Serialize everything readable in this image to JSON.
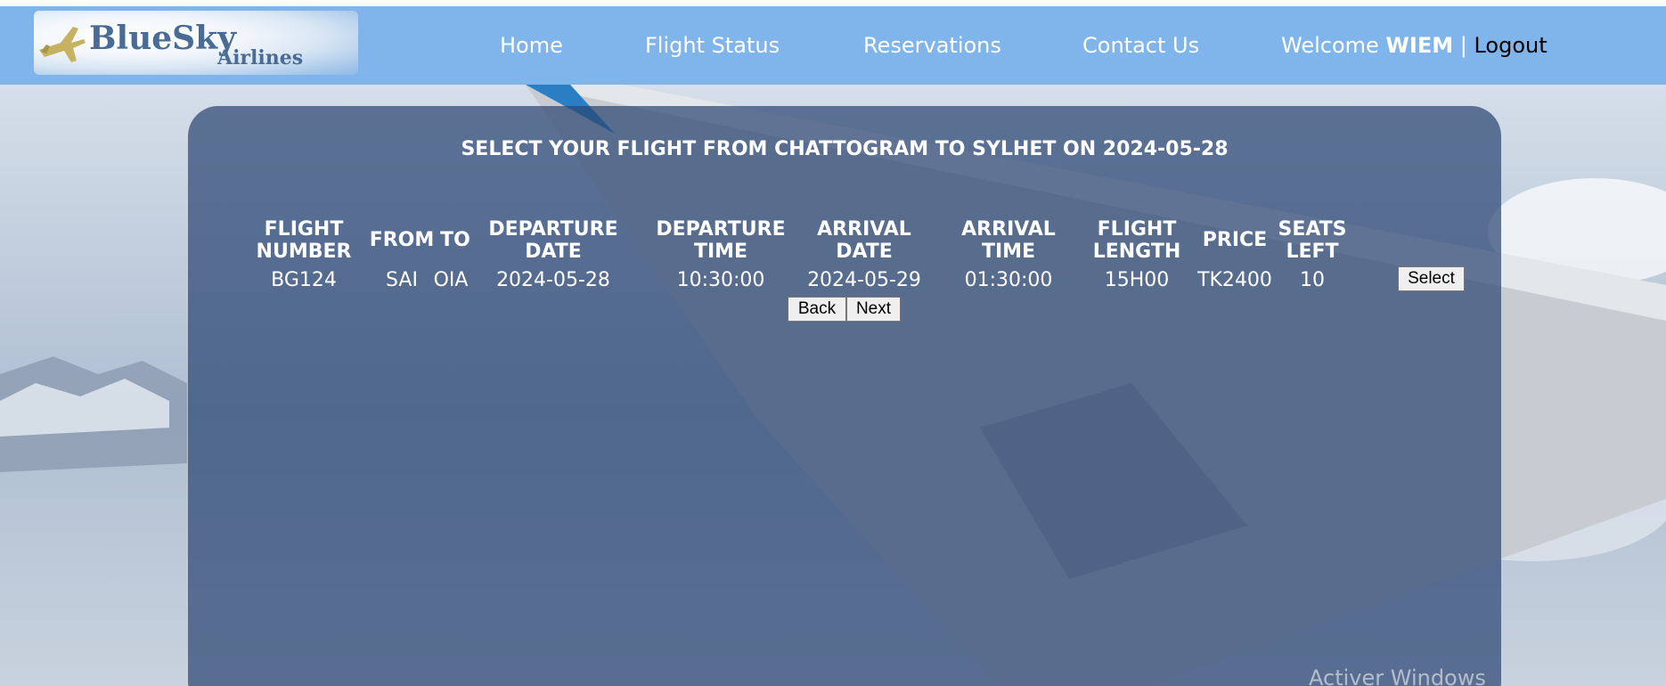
{
  "header": {
    "logo": {
      "brand": "BlueSky",
      "sub": "Airlines"
    },
    "nav": {
      "home": "Home",
      "flight_status": "Flight Status",
      "reservations": "Reservations",
      "contact_us": "Contact Us"
    },
    "welcome": {
      "prefix": "Welcome",
      "user": "WIEM",
      "separator": "|",
      "logout": "Logout"
    }
  },
  "main": {
    "title": "SELECT YOUR FLIGHT FROM CHATTOGRAM TO SYLHET ON 2024-05-28",
    "columns": {
      "flight_number": [
        "FLIGHT",
        "NUMBER"
      ],
      "from": "FROM",
      "to": "TO",
      "departure_date": [
        "DEPARTURE",
        "DATE"
      ],
      "departure_time": [
        "DEPARTURE",
        "TIME"
      ],
      "arrival_date": [
        "ARRIVAL",
        "DATE"
      ],
      "arrival_time": [
        "ARRIVAL",
        "TIME"
      ],
      "flight_length": [
        "FLIGHT",
        "LENGTH"
      ],
      "price": "PRICE",
      "seats_left": [
        "SEATS",
        "LEFT"
      ]
    },
    "rows": [
      {
        "flight_number": "BG124",
        "from": "SAI",
        "to": "OIA",
        "departure_date": "2024-05-28",
        "departure_time": "10:30:00",
        "arrival_date": "2024-05-29",
        "arrival_time": "01:30:00",
        "flight_length": "15H00",
        "price": "TK2400",
        "seats_left": "10",
        "action": "Select"
      }
    ],
    "pagination": {
      "back": "Back",
      "next": "Next"
    }
  },
  "overlay": {
    "watermark": "Activer Windows"
  },
  "colors": {
    "header_bg": "#7fb5eb",
    "panel_bg": "#2d4673",
    "text": "#ffffff",
    "logo_text": "#4a6b93"
  }
}
